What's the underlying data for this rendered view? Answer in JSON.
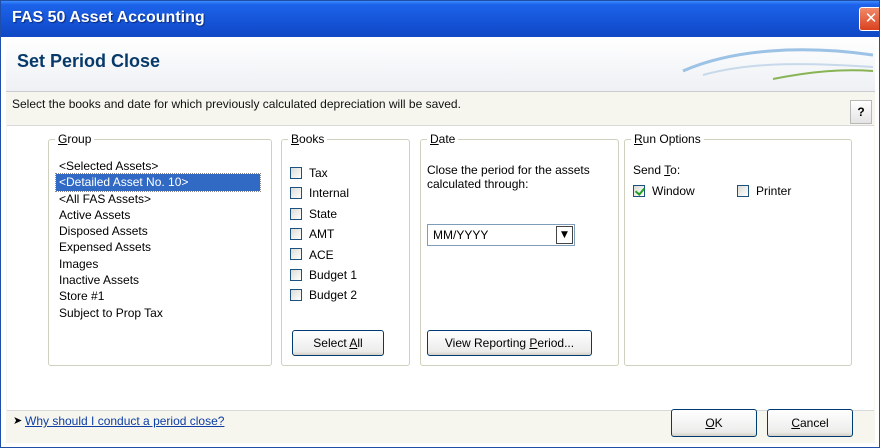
{
  "window": {
    "title": "FAS 50 Asset Accounting",
    "close_glyph": "✕"
  },
  "header": {
    "heading": "Set Period Close"
  },
  "instruction": "Select the books and date for which previously calculated depreciation will be saved.",
  "help": {
    "label": "?"
  },
  "group": {
    "legend_key": "G",
    "legend_rest": "roup",
    "items": [
      "<Selected Assets>",
      "<Detailed Asset No. 10>",
      "<All FAS Assets>",
      "Active Assets",
      "Disposed Assets",
      "Expensed Assets",
      "Images",
      "Inactive Assets",
      "Store #1",
      "Subject to Prop Tax"
    ],
    "selected_index": 1
  },
  "books": {
    "legend_key": "B",
    "legend_rest": "ooks",
    "items": [
      {
        "label": "Tax",
        "checked": false
      },
      {
        "label": "Internal",
        "checked": false
      },
      {
        "label": "State",
        "checked": false
      },
      {
        "label": "AMT",
        "checked": false
      },
      {
        "label": "ACE",
        "checked": false
      },
      {
        "label": "Budget 1",
        "checked": false
      },
      {
        "label": "Budget 2",
        "checked": false
      }
    ],
    "select_all_prefix": "Select ",
    "select_all_key": "A",
    "select_all_rest": "ll"
  },
  "date": {
    "legend_key": "D",
    "legend_rest": "ate",
    "prompt": "Close the period for the assets calculated through:",
    "select_value": "MM/YYYY",
    "select_arrow": "▼",
    "view_prefix": "View Reporting ",
    "view_key": "P",
    "view_rest": "eriod..."
  },
  "run_options": {
    "legend_key": "R",
    "legend_rest": "un Options",
    "send_to_prefix": "Send ",
    "send_to_key": "T",
    "send_to_rest": "o:",
    "window_label": "Window",
    "window_checked": true,
    "printer_label": "Printer",
    "printer_checked": false
  },
  "footer": {
    "arrow": "➤",
    "link": "Why should I conduct a period close?",
    "ok_key": "O",
    "ok_rest": "K",
    "cancel_key": "C",
    "cancel_rest": "ancel"
  },
  "colors": {
    "title_bar": "#1553d6",
    "heading": "#073a6b",
    "selection": "#316ac5",
    "link": "#0e3ea4"
  }
}
